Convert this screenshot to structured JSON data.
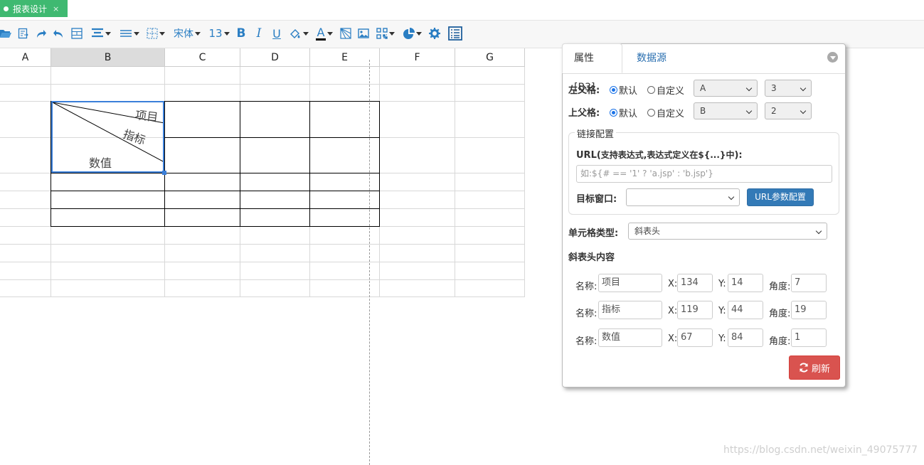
{
  "tab": {
    "label": "报表设计",
    "close": "×"
  },
  "toolbar": {
    "font_family": "宋体",
    "font_size": "13",
    "bold": "B",
    "italic": "I",
    "underline": "U",
    "font_color_letter": "A"
  },
  "grid": {
    "columns": [
      "A",
      "B",
      "C",
      "D",
      "E",
      "F",
      "G"
    ],
    "selected_column": "B",
    "diagonal_header": {
      "top": "项目",
      "middle": "指标",
      "bottom": "数值"
    }
  },
  "panel": {
    "tab_properties": "属性[B3]",
    "tab_datasource": "数据源",
    "left_parent_label": "左父格:",
    "top_parent_label": "上父格:",
    "radio_default": "默认",
    "radio_custom": "自定义",
    "left_parent_col": "A",
    "left_parent_row": "3",
    "top_parent_col": "B",
    "top_parent_row": "2",
    "link_legend": "链接配置",
    "url_label": "URL(",
    "url_label_hint": "支持表达式,表达式定义在${...}中",
    "url_label_end": "):",
    "url_placeholder": "如:${# == '1' ? 'a.jsp' : 'b.jsp'}",
    "target_label": "目标窗口:",
    "target_value": "",
    "url_param_button": "URL参数配置",
    "cell_type_label": "单元格类型:",
    "cell_type_value": "斜表头",
    "slash_section_title": "斜表头内容",
    "name_label": "名称:",
    "x_label": "X:",
    "y_label": "Y:",
    "angle_label": "角度:",
    "rows": [
      {
        "name": "项目",
        "x": "134",
        "y": "14",
        "angle": "7"
      },
      {
        "name": "指标",
        "x": "119",
        "y": "44",
        "angle": "19"
      },
      {
        "name": "数值",
        "x": "67",
        "y": "84",
        "angle": "1"
      }
    ],
    "refresh_button": "刷新"
  },
  "watermark": "https://blog.csdn.net/weixin_49075777"
}
